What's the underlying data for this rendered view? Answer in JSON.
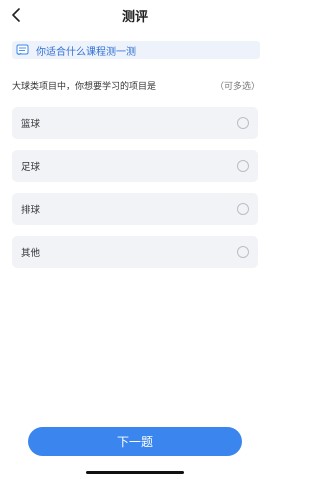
{
  "nav": {
    "title": "测评",
    "back_icon": "chevron-left-icon"
  },
  "banner": {
    "icon": "scroll-icon",
    "text": "你适合什么课程测一测",
    "text_color": "#2f6fd6",
    "background": "#eef3fb"
  },
  "question": {
    "text": "大球类项目中，你想要学习的项目是",
    "hint": "（可多选）"
  },
  "options": [
    {
      "label": "篮球",
      "selected": false
    },
    {
      "label": "足球",
      "selected": false
    },
    {
      "label": "排球",
      "selected": false
    },
    {
      "label": "其他",
      "selected": false
    }
  ],
  "next_button": {
    "label": "下一题",
    "color": "#3a86ee"
  }
}
